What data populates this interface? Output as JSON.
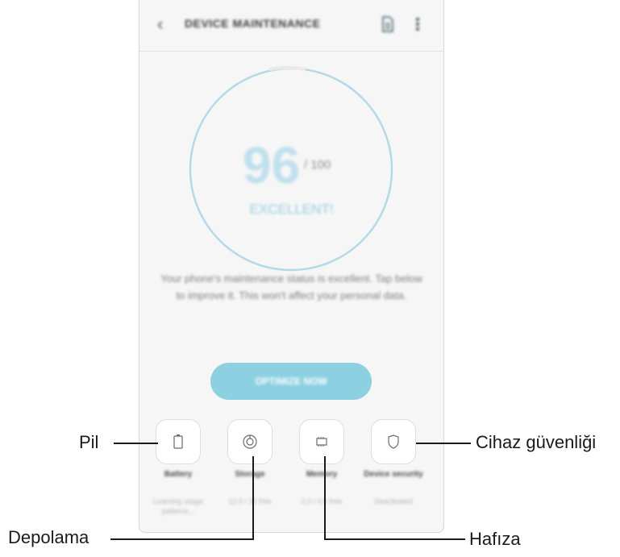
{
  "screen": {
    "title": "DEVICE MAINTENANCE",
    "score": "96",
    "score_max": "/ 100",
    "status": "EXCELLENT!",
    "description": "Your phone's maintenance status is excellent. Tap below to improve it. This won't affect your personal data.",
    "optimize_button": "OPTIMIZE NOW"
  },
  "tiles": [
    {
      "label": "Battery",
      "sub": "Learning usage patterns..."
    },
    {
      "label": "Storage",
      "sub": "12.0 / 32 free"
    },
    {
      "label": "Memory",
      "sub": "2.0 / 4.0 free"
    },
    {
      "label": "Device security",
      "sub": "Deactivated"
    }
  ],
  "callouts": {
    "battery": "Pil",
    "storage": "Depolama",
    "memory": "Hafıza",
    "security": "Cihaz güvenliği"
  },
  "colors": {
    "accent": "#8dd0e1",
    "ring": "#b5d9e6",
    "score": "#bfe0ec"
  },
  "icons": [
    "back-arrow-icon",
    "document-icon",
    "more-vert-icon",
    "battery-icon",
    "storage-icon",
    "memory-chip-icon",
    "shield-icon"
  ]
}
